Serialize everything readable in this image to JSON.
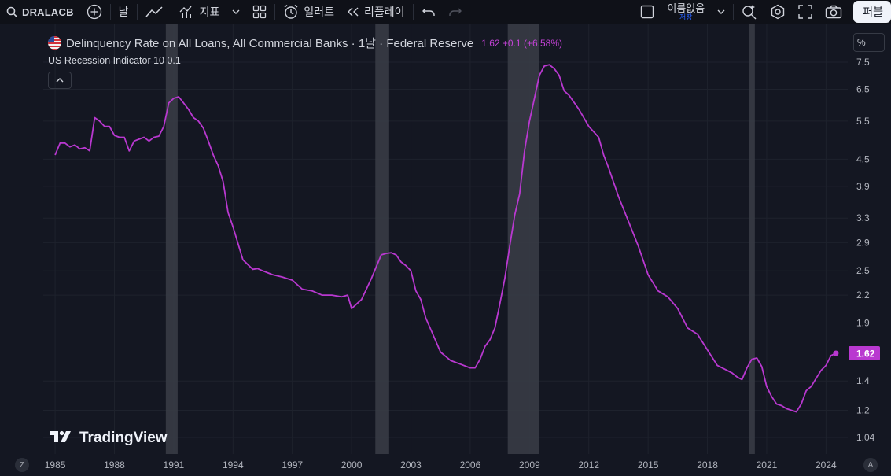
{
  "toolbar": {
    "symbol": "DRALACB",
    "interval": "날",
    "indicators_label": "지표",
    "alerts_label": "얼러트",
    "replay_label": "리플레이",
    "layout_name": "이름없음",
    "layout_status": "저장",
    "publish_label": "퍼블"
  },
  "legend": {
    "title": "Delinquency Rate on All Loans, All Commercial Banks · 1날 · Federal Reserve",
    "last_value": "1.62",
    "change": "+0.1",
    "change_pct": "(+6.58%)",
    "indicator": "US Recession Indicator 10 0.1"
  },
  "scale_mode": "%",
  "watermark": "TradingView",
  "bottom_left": "Z",
  "bottom_right": "A",
  "colors": {
    "line": "#b938d0",
    "background": "#141722",
    "recession_band": "#3a3d46"
  },
  "chart_data": {
    "type": "line",
    "title": "Delinquency Rate on All Loans, All Commercial Banks",
    "yscale": "log",
    "ylim": [
      1.0,
      8.0
    ],
    "y_ticks": [
      "7.5",
      "6.5",
      "5.5",
      "4.5",
      "3.9",
      "3.3",
      "2.9",
      "2.5",
      "2.2",
      "1.9",
      "1.4",
      "1.2",
      "1.04"
    ],
    "x_ticks": [
      "1985",
      "1988",
      "1991",
      "1994",
      "1997",
      "2000",
      "2003",
      "2006",
      "2009",
      "2012",
      "2015",
      "2018",
      "2021",
      "2024"
    ],
    "xlim": [
      1984.4,
      2025.1
    ],
    "last_label": "1.62",
    "recessions": [
      [
        1990.6,
        1991.2
      ],
      [
        2001.2,
        2001.9
      ],
      [
        2007.9,
        2009.5
      ],
      [
        2020.1,
        2020.4
      ]
    ],
    "series": [
      {
        "x": [
          1985.0,
          1985.25,
          1985.5,
          1985.75,
          1986.0,
          1986.25,
          1986.5,
          1986.75,
          1987.0,
          1987.25,
          1987.5,
          1987.75,
          1988.0,
          1988.25,
          1988.5,
          1988.75,
          1989.0,
          1989.25,
          1989.5,
          1989.75,
          1990.0,
          1990.25,
          1990.5,
          1990.75,
          1991.0,
          1991.25,
          1991.5,
          1991.75,
          1992.0,
          1992.25,
          1992.5,
          1992.75,
          1993.0,
          1993.25,
          1993.5,
          1993.75,
          1994.0,
          1994.5,
          1995.0,
          1995.25,
          1995.5,
          1996.0,
          1996.5,
          1997.0,
          1997.5,
          1998.0,
          1998.5,
          1999.0,
          1999.5,
          1999.8,
          2000.0,
          2000.5,
          2001.0,
          2001.5,
          2001.75,
          2002.0,
          2002.25,
          2002.5,
          2002.75,
          2003.0,
          2003.25,
          2003.5,
          2003.75,
          2004.0,
          2004.5,
          2005.0,
          2005.5,
          2006.0,
          2006.25,
          2006.5,
          2006.75,
          2007.0,
          2007.25,
          2007.5,
          2007.75,
          2008.0,
          2008.25,
          2008.5,
          2008.75,
          2009.0,
          2009.25,
          2009.5,
          2009.75,
          2010.0,
          2010.25,
          2010.5,
          2010.75,
          2011.0,
          2011.5,
          2012.0,
          2012.5,
          2012.75,
          2013.0,
          2013.5,
          2014.0,
          2014.5,
          2015.0,
          2015.5,
          2016.0,
          2016.5,
          2017.0,
          2017.5,
          2018.0,
          2018.5,
          2019.0,
          2019.25,
          2019.5,
          2019.75,
          2020.0,
          2020.25,
          2020.5,
          2020.75,
          2021.0,
          2021.25,
          2021.5,
          2021.75,
          2022.0,
          2022.25,
          2022.5,
          2022.75,
          2023.0,
          2023.25,
          2023.5,
          2023.75,
          2024.0,
          2024.25,
          2024.5
        ],
        "y": [
          4.6,
          4.9,
          4.9,
          4.8,
          4.85,
          4.75,
          4.78,
          4.7,
          5.6,
          5.5,
          5.35,
          5.35,
          5.1,
          5.05,
          5.05,
          4.7,
          4.95,
          5.0,
          5.05,
          4.95,
          5.05,
          5.08,
          5.35,
          6.05,
          6.2,
          6.25,
          6.05,
          5.85,
          5.6,
          5.5,
          5.3,
          4.95,
          4.6,
          4.35,
          4.0,
          3.4,
          3.15,
          2.65,
          2.52,
          2.53,
          2.5,
          2.45,
          2.42,
          2.38,
          2.27,
          2.25,
          2.2,
          2.2,
          2.18,
          2.2,
          2.05,
          2.15,
          2.4,
          2.72,
          2.74,
          2.75,
          2.72,
          2.62,
          2.57,
          2.5,
          2.25,
          2.15,
          1.95,
          1.84,
          1.63,
          1.56,
          1.53,
          1.5,
          1.5,
          1.57,
          1.68,
          1.74,
          1.85,
          2.1,
          2.4,
          2.85,
          3.35,
          3.75,
          4.7,
          5.5,
          6.2,
          7.0,
          7.35,
          7.4,
          7.25,
          7.0,
          6.45,
          6.3,
          5.85,
          5.35,
          5.05,
          4.6,
          4.3,
          3.7,
          3.25,
          2.85,
          2.45,
          2.25,
          2.18,
          2.05,
          1.85,
          1.79,
          1.65,
          1.52,
          1.48,
          1.46,
          1.43,
          1.41,
          1.5,
          1.57,
          1.58,
          1.51,
          1.36,
          1.29,
          1.24,
          1.23,
          1.21,
          1.2,
          1.19,
          1.24,
          1.33,
          1.36,
          1.42,
          1.48,
          1.52,
          1.6,
          1.62
        ]
      }
    ]
  }
}
